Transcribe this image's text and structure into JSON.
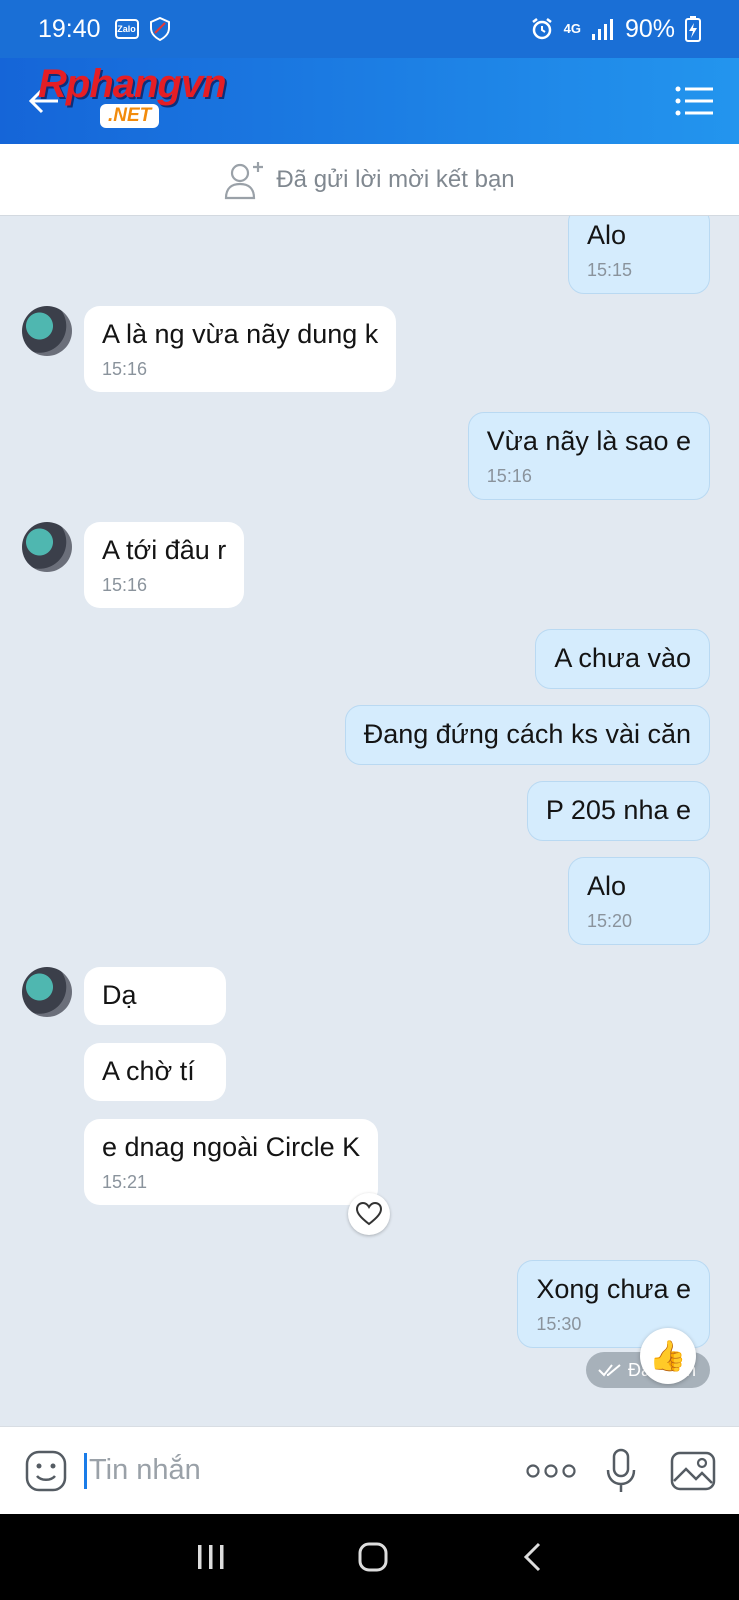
{
  "status_bar": {
    "time": "19:40",
    "zalo_badge": "Zalo",
    "network": "4G",
    "battery": "90%"
  },
  "header": {
    "logo_brand": "Rphangvn",
    "logo_sub": ".NET"
  },
  "friend_request": {
    "label": "Đã gửi lời mời kết bạn"
  },
  "messages": [
    {
      "from": "me",
      "text": "Alo",
      "time": "15:15"
    },
    {
      "from": "them",
      "text": "A là ng vừa nãy dung k",
      "time": "15:16"
    },
    {
      "from": "me",
      "text": "Vừa nãy là sao e",
      "time": "15:16"
    },
    {
      "from": "them",
      "text": "A tới đâu r",
      "time": "15:16"
    },
    {
      "from": "me",
      "text": "A chưa vào",
      "time": ""
    },
    {
      "from": "me",
      "text": "Đang đứng cách ks vài căn",
      "time": ""
    },
    {
      "from": "me",
      "text": "P 205 nha e",
      "time": ""
    },
    {
      "from": "me",
      "text": "Alo",
      "time": "15:20"
    },
    {
      "from": "them",
      "text": "Dạ",
      "time": ""
    },
    {
      "from": "them",
      "text": "A chờ tí",
      "time": ""
    },
    {
      "from": "them",
      "text": "e dnag ngoài Circle K",
      "time": "15:21"
    },
    {
      "from": "me",
      "text": "Xong chưa e",
      "time": "15:30"
    }
  ],
  "seen_label": "Đã nhận",
  "input": {
    "placeholder": "Tin nhắn"
  },
  "icons": {
    "accent": "#1a6fd6",
    "bubble_out": "#d5ecfd",
    "bubble_in": "#ffffff"
  }
}
